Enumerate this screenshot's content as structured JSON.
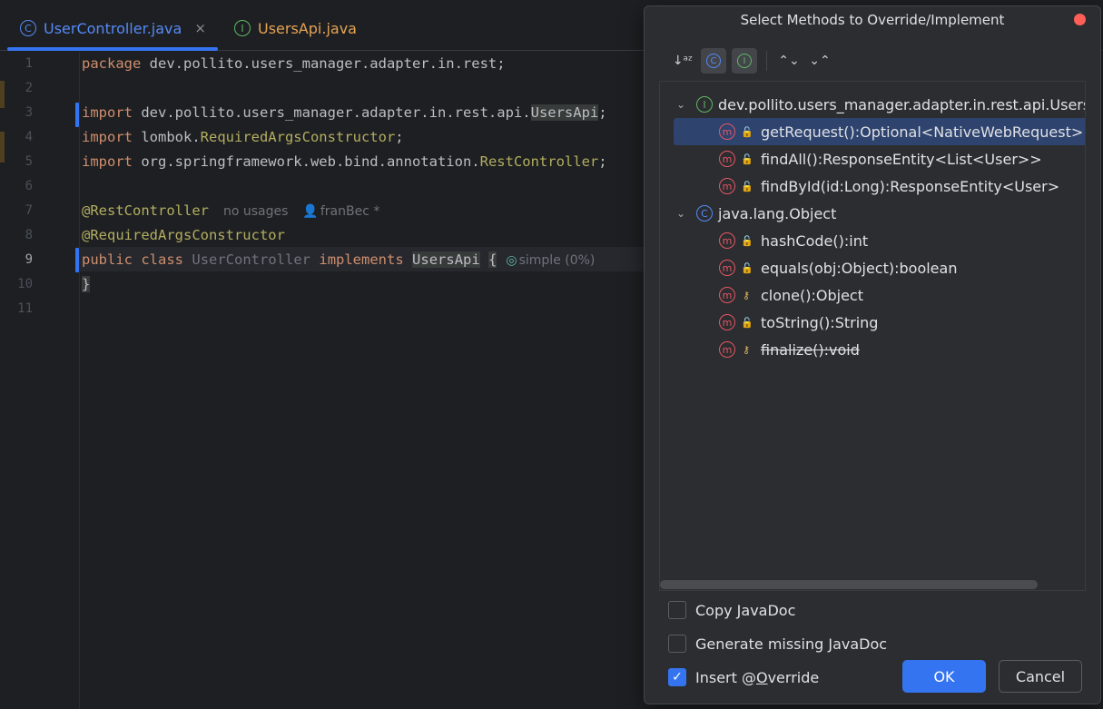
{
  "editor": {
    "tabs": [
      {
        "label": "UserController.java",
        "icon": "C",
        "close": "×"
      },
      {
        "label": "UsersApi.java",
        "icon": "I"
      }
    ],
    "line_numbers": [
      "1",
      "2",
      "3",
      "4",
      "5",
      "6",
      "7",
      "8",
      "9",
      "10",
      "11"
    ],
    "code": {
      "l1_kw": "package",
      "l1_rest": " dev.pollito.users_manager.adapter.in.rest;",
      "l3_kw": "import",
      "l3_pkg": " dev.pollito.users_manager.adapter.in.rest.api.",
      "l3_cls": "UsersApi",
      "l3_end": ";",
      "l4_kw": "import",
      "l4_pkg": " lombok.",
      "l4_cls": "RequiredArgsConstructor",
      "l4_end": ";",
      "l5_kw": "import",
      "l5_pkg": " org.springframework.web.bind.annotation.",
      "l5_cls": "RestController",
      "l5_end": ";",
      "l7_ann": "@RestController",
      "l7_usages": "no usages",
      "l7_author": "franBec *",
      "l8_ann": "@RequiredArgsConstructor",
      "l9_kw1": "public",
      "l9_kw2": "class",
      "l9_name": "UserController",
      "l9_kw3": "implements",
      "l9_iface": "UsersApi",
      "l9_brace": "{",
      "l9_hint": "simple (0%)",
      "l10": "}"
    }
  },
  "dialog": {
    "title": "Select Methods to Override/Implement",
    "tree": {
      "groups": [
        {
          "label": "dev.pollito.users_manager.adapter.in.rest.api.UsersApi",
          "methods": [
            {
              "label": "getRequest():Optional<NativeWebRequest>"
            },
            {
              "label": "findAll():ResponseEntity<List<User>>"
            },
            {
              "label": "findById(id:Long):ResponseEntity<User>"
            }
          ]
        },
        {
          "label": "java.lang.Object",
          "methods": [
            {
              "label": "hashCode():int"
            },
            {
              "label": "equals(obj:Object):boolean"
            },
            {
              "label": "clone():Object"
            },
            {
              "label": "toString():String"
            },
            {
              "label": "finalize():void"
            }
          ]
        }
      ]
    },
    "options": {
      "copy_javadoc_a": "Copy ",
      "copy_javadoc_u": "J",
      "copy_javadoc_b": "avaDoc",
      "gen_javadoc": "Generate missing JavaDoc",
      "insert_override_a": "Insert @",
      "insert_override_u": "O",
      "insert_override_b": "verride"
    },
    "buttons": {
      "ok": "OK",
      "cancel": "Cancel"
    }
  }
}
